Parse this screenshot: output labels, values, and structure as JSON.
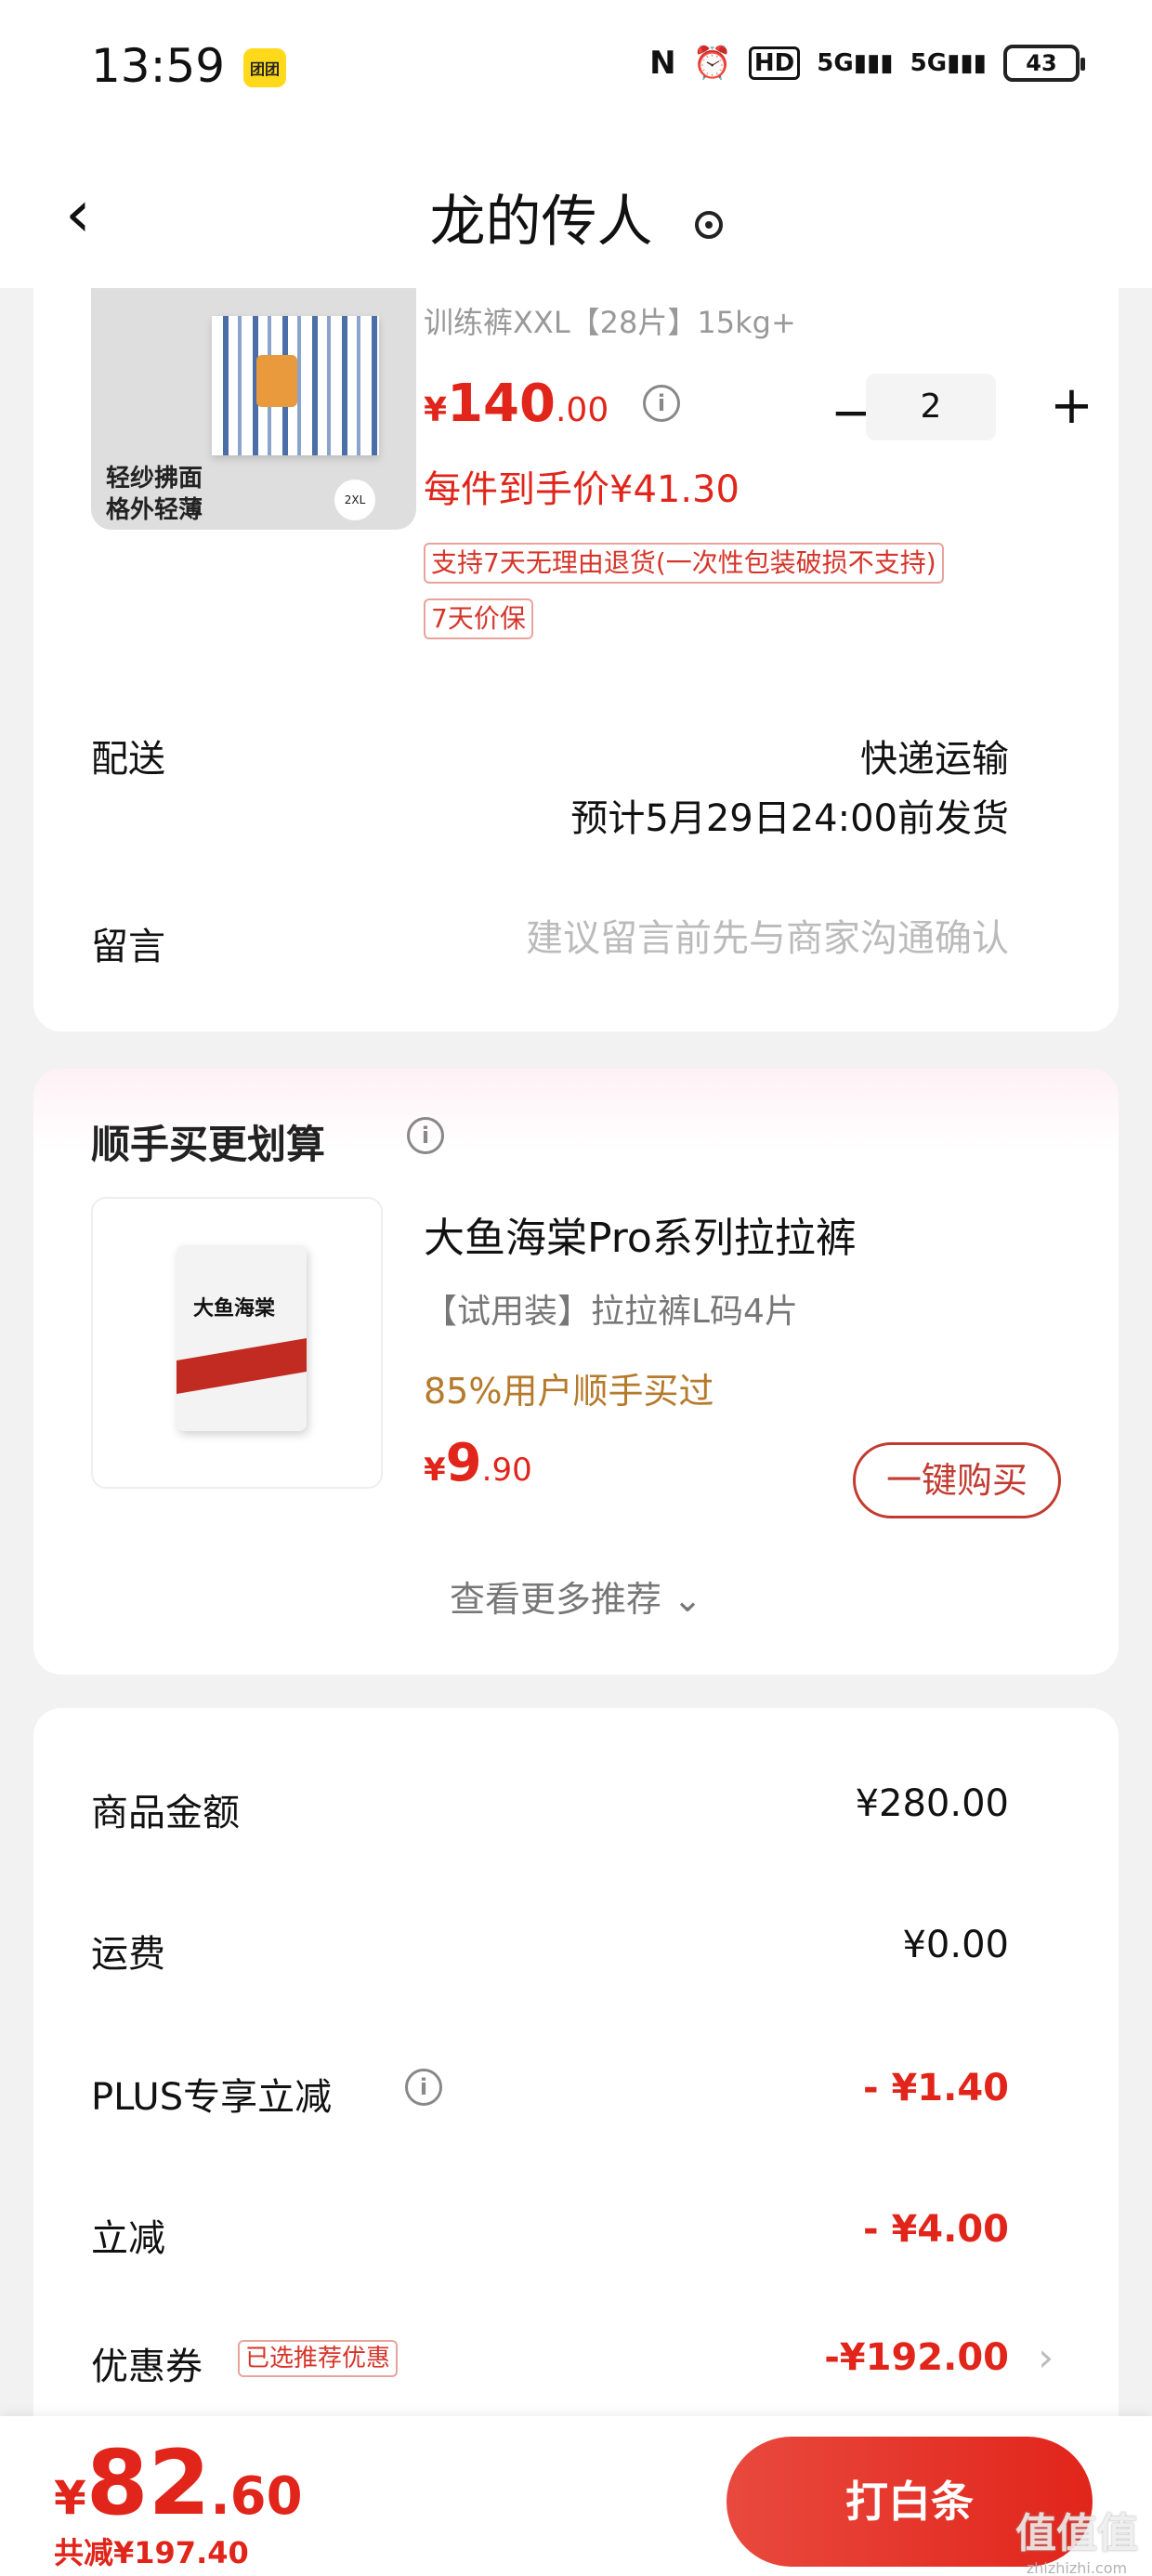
{
  "status_bar": {
    "time": "13:59",
    "app_badge": "团团",
    "nfc": "N",
    "hd": "HD",
    "signal1": "5G",
    "signal2": "5G",
    "battery": "43"
  },
  "header": {
    "title": "龙的传人"
  },
  "product": {
    "spec": "训练裤XXL【28片】15kg+",
    "image_text_line1": "轻纱拂面",
    "image_text_line2": "格外轻薄",
    "image_size_badge": "2XL",
    "price_yen": "¥",
    "price_int": "140",
    "price_dec": ".00",
    "quantity": "2",
    "minus": "−",
    "plus": "+",
    "per_item_price": "每件到手价¥41.30",
    "tag_return": "支持7天无理由退货(一次性包装破损不支持)",
    "tag_price_protect": "7天价保"
  },
  "delivery": {
    "label": "配送",
    "method": "快递运输",
    "date": "预计5月29日24:00前发货"
  },
  "note": {
    "label": "留言",
    "placeholder": "建议留言前先与商家沟通确认"
  },
  "addon": {
    "title": "顺手买更划算",
    "pack_logo": "大鱼海棠",
    "name": "大鱼海棠Pro系列拉拉裤",
    "spec": "【试用装】拉拉裤L码4片",
    "social": "85%用户顺手买过",
    "price_yen": "¥",
    "price_int": "9",
    "price_dec": ".90",
    "buy_label": "一键购买",
    "more_label": "查看更多推荐 ⌄"
  },
  "summary": {
    "goods_label": "商品金额",
    "goods_value": "¥280.00",
    "shipping_label": "运费",
    "shipping_value": "¥0.00",
    "plus_label": "PLUS专享立减",
    "plus_value": "- ¥1.40",
    "discount_label": "立减",
    "discount_value": "- ¥4.00",
    "coupon_label": "优惠券",
    "coupon_tag": "已选推荐优惠",
    "coupon_value": "-¥192.00"
  },
  "footer": {
    "total_yen": "¥",
    "total_int": "82",
    "total_dec": ".60",
    "saved": "共减¥197.40",
    "pay_label": "打白条",
    "watermark": "值值值",
    "watermark_sub": "zhizhizhi.com"
  },
  "colors": {
    "accent_red": "#e1251b",
    "tag_border": "#e8a49c",
    "social_gold": "#b57a2b",
    "page_bg": "#f2f2f2"
  },
  "icons": [
    "back-chevron-icon",
    "location-pin-icon",
    "info-icon",
    "chevron-right-icon",
    "chevron-down-icon",
    "nfc-icon",
    "alarm-icon",
    "signal-icon",
    "battery-icon"
  ]
}
